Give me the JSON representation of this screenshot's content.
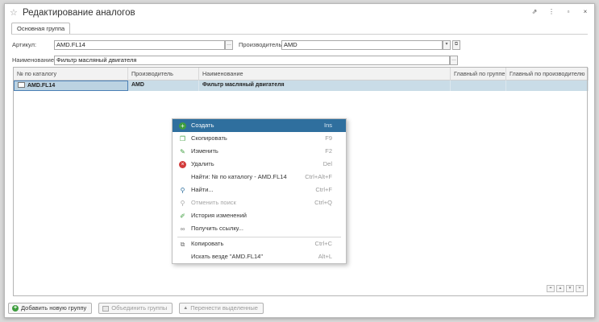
{
  "window": {
    "title": "Редактирование аналогов",
    "controls": [
      "⇗",
      "⋮",
      "▫",
      "×"
    ]
  },
  "tab": {
    "label": "Основная группа"
  },
  "form": {
    "article_label": "Артикул:",
    "article_value": "AMD.FL14",
    "manufacturer_label": "Производитель:",
    "manufacturer_value": "AMD",
    "name_label": "Наименование:",
    "name_value": "Фильтр масляный двигателя"
  },
  "grid": {
    "columns": [
      "№ по каталогу",
      "Производитель",
      "Наименование",
      "Главный по группе",
      "Главный по производителю"
    ],
    "rows": [
      {
        "catalog_no": "AMD.FL14",
        "manufacturer": "AMD",
        "name": "Фильтр масляный двигателя",
        "main_group": "",
        "main_manufacturer": ""
      }
    ]
  },
  "context_menu": {
    "items": [
      {
        "label": "Создать",
        "shortcut": "Ins",
        "icon": "plus-circle-icon"
      },
      {
        "label": "Скопировать",
        "shortcut": "F9",
        "icon": "copy-doc-icon"
      },
      {
        "label": "Изменить",
        "shortcut": "F2",
        "icon": "pencil-icon"
      },
      {
        "label": "Удалить",
        "shortcut": "Del",
        "icon": "delete-circle-icon"
      },
      {
        "label": "Найти: № по каталогу - AMD.FL14",
        "shortcut": "Ctrl+Alt+F",
        "icon": ""
      },
      {
        "label": "Найти...",
        "shortcut": "Ctrl+F",
        "icon": "search-icon"
      },
      {
        "label": "Отменить поиск",
        "shortcut": "Ctrl+Q",
        "icon": "search-cancel-icon"
      },
      {
        "label": "История изменений",
        "shortcut": "",
        "icon": "history-icon"
      },
      {
        "label": "Получить ссылку...",
        "shortcut": "",
        "icon": "link-icon"
      },
      {
        "label": "Копировать",
        "shortcut": "Ctrl+C",
        "icon": "clipboard-icon"
      },
      {
        "label": "Искать везде \"AMD.FL14\"",
        "shortcut": "Alt+L",
        "icon": ""
      }
    ]
  },
  "bottom": {
    "add_group": "Добавить новую группу",
    "merge_groups": "Объединить группы",
    "move_selected": "Перенести выделенные"
  },
  "colors": {
    "selection": "#2f6f9e",
    "row_highlight": "#c9dce7",
    "green": "#3e9d3e",
    "red": "#d23b3b"
  }
}
